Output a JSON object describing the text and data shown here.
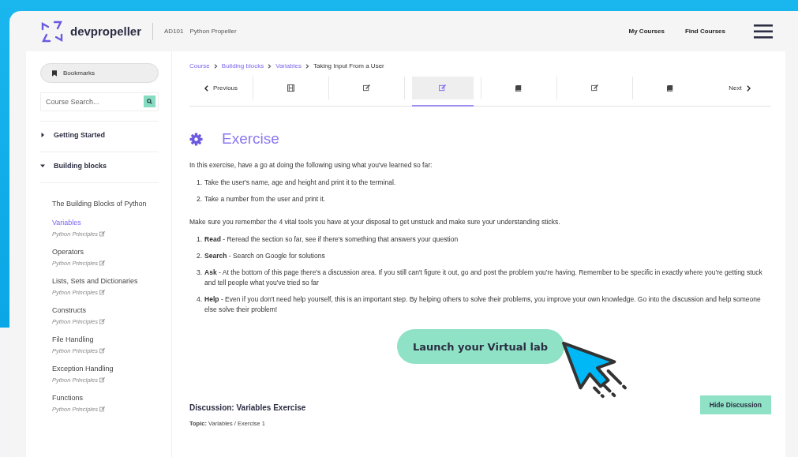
{
  "header": {
    "logo_text": "devpropeller",
    "course_code": "AD101",
    "course_name": "Python Propeller",
    "nav": [
      "My Courses",
      "Find Courses"
    ]
  },
  "sidebar": {
    "bookmarks": "Bookmarks",
    "search": {
      "placeholder": "Course Search..."
    },
    "sections": [
      {
        "title": "Getting Started",
        "expanded": false
      },
      {
        "title": "Building blocks",
        "expanded": true,
        "children": [
          {
            "title": "The Building Blocks of Python",
            "selected": false
          },
          {
            "title": "Variables",
            "subtitle": "Python Principles",
            "selected": true
          },
          {
            "title": "Operators",
            "subtitle": "Python Principles",
            "selected": false
          },
          {
            "title": "Lists, Sets and Dictionaries",
            "subtitle": "Python Principles",
            "selected": false
          },
          {
            "title": "Constructs",
            "subtitle": "Python Principles",
            "selected": false
          },
          {
            "title": "File Handling",
            "subtitle": "Python Principles",
            "selected": false
          },
          {
            "title": "Exception Handling",
            "subtitle": "Python Principles",
            "selected": false
          },
          {
            "title": "Functions",
            "subtitle": "Python Principles",
            "selected": false
          }
        ]
      }
    ]
  },
  "breadcrumb": [
    "Course",
    "Building blocks",
    "Variables",
    "Taking Input From a User"
  ],
  "steps": {
    "previous": "Previous",
    "next": "Next",
    "items": [
      {
        "kind": "film",
        "selected": false
      },
      {
        "kind": "edit",
        "selected": false
      },
      {
        "kind": "edit",
        "selected": true
      },
      {
        "kind": "book",
        "selected": false
      },
      {
        "kind": "edit",
        "selected": false
      },
      {
        "kind": "book",
        "selected": false
      }
    ]
  },
  "exercise": {
    "title": "Exercise",
    "intro": "In this exercise, have a go at doing the following using what you've learned so far:",
    "tasks": [
      {
        "number": "1.",
        "text": "Take the user's name, age and height and print it to the terminal."
      },
      {
        "number": "2.",
        "text": "Take a number from the user and print it."
      }
    ],
    "tools_intro": "Make sure you remember the 4 vital tools you have at your disposal to get unstuck and make sure your understanding sticks.",
    "tools": [
      {
        "number": "1.",
        "text": "**Read** - Reread the section so far, see if there's something that answers your question"
      },
      {
        "number": "2.",
        "text": "**Search** - Search on Google for solutions"
      },
      {
        "number": "3.",
        "text": "**Ask** - At the bottom of this page there's a discussion area. If you still can't figure it out, go and post the problem you're having. Remember to be specific in exactly where you're getting stuck and tell people what you've tried so far"
      },
      {
        "number": "4.",
        "text": "**Help** - Even if you don't need help yourself, this is an important step. By helping others to solve their problems, you improve your own knowledge. Go into the discussion and help someone else solve their problem!"
      }
    ],
    "launch": "Launch your Virtual lab"
  },
  "discussion": {
    "title": "Discussion: Variables Exercise",
    "topic": "**Topic:** Variables / Exercise 1",
    "hide": "Hide Discussion"
  }
}
